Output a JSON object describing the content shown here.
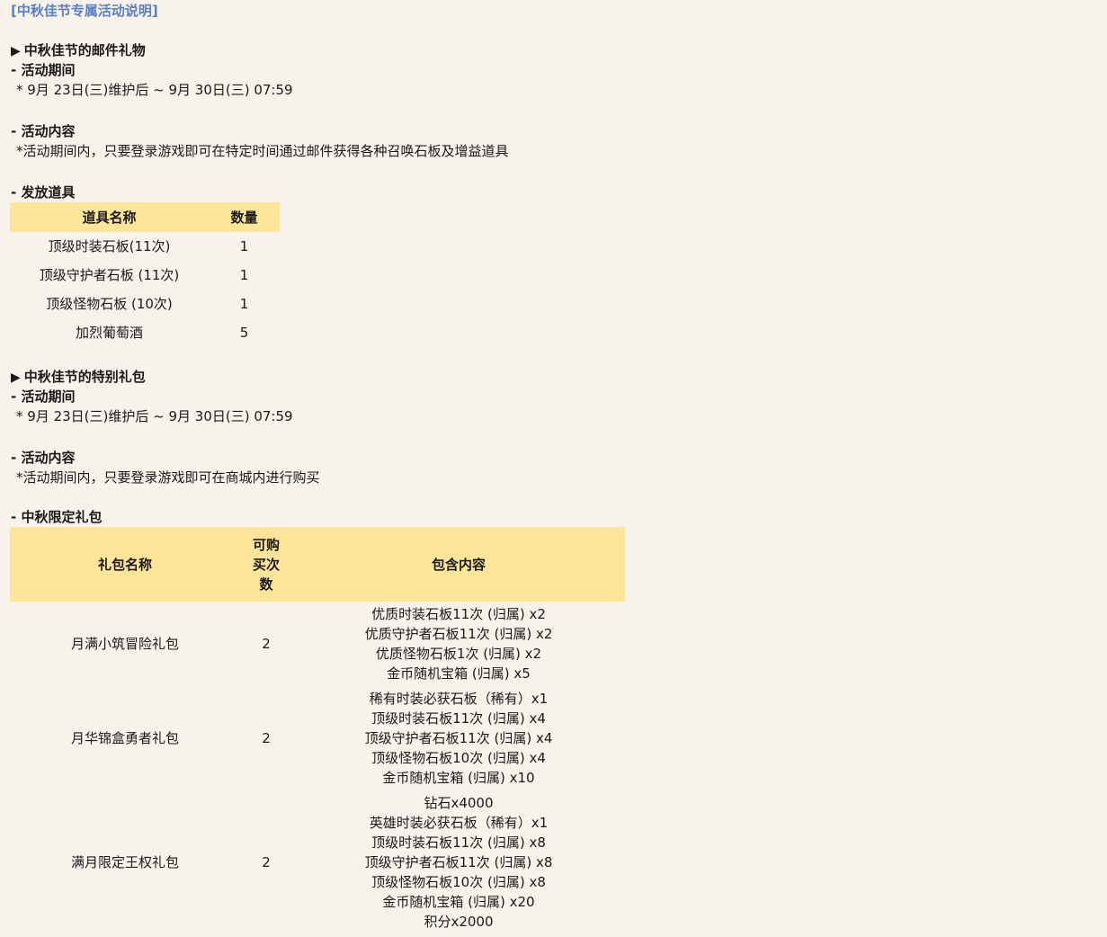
{
  "title": "[中秋佳节专属活动说明]",
  "section1": {
    "heading": "中秋佳节的邮件礼物",
    "period_label": "- 活动期间",
    "period_text": "* 9月 23日(三)维护后 ~ 9月 30日(三) 07:59",
    "content_label": "- 活动内容",
    "content_text": "*活动期间内，只要登录游戏即可在特定时间通过邮件获得各种召唤石板及增益道具",
    "items_label": "- 发放道具",
    "table": {
      "headers": [
        "道具名称",
        "数量"
      ],
      "rows": [
        [
          "顶级时装石板(11次)",
          "1"
        ],
        [
          "顶级守护者石板 (11次)",
          "1"
        ],
        [
          "顶级怪物石板 (10次)",
          "1"
        ],
        [
          "加烈葡萄酒",
          "5"
        ]
      ]
    }
  },
  "section2": {
    "heading": "中秋佳节的特别礼包",
    "period_label": "- 活动期间",
    "period_text": "* 9月 23日(三)维护后 ~ 9月 30日(三) 07:59",
    "content_label": "- 活动内容",
    "content_text": "*活动期间内，只要登录游戏即可在商城内进行购买",
    "packs_label": "- 中秋限定礼包",
    "table": {
      "headers": [
        "礼包名称",
        "可购\n买次\n数",
        "包含内容"
      ],
      "rows": [
        {
          "name": "月满小筑冒险礼包",
          "limit": "2",
          "contents": [
            "优质时装石板11次 (归属) x2",
            "优质守护者石板11次 (归属) x2",
            "优质怪物石板1次 (归属) x2",
            "金币随机宝箱 (归属) x5"
          ]
        },
        {
          "name": "月华锦盒勇者礼包",
          "limit": "2",
          "contents": [
            "稀有时装必获石板（稀有）x1",
            "顶级时装石板11次 (归属) x4",
            "顶级守护者石板11次 (归属) x4",
            "顶级怪物石板10次 (归属) x4",
            "金币随机宝箱 (归属) x10"
          ]
        },
        {
          "name": "满月限定王权礼包",
          "limit": "2",
          "contents": [
            "钻石x4000",
            "英雄时装必获石板（稀有）x1",
            "顶级时装石板11次 (归属) x8",
            "顶级守护者石板11次 (归属) x8",
            "顶级怪物石板10次 (归属) x8",
            "金币随机宝箱 (归属) x20",
            "积分x2000"
          ]
        }
      ]
    }
  },
  "icons": {
    "bullet": "triangle-right-icon"
  },
  "colors": {
    "background": "#f7f2ea",
    "title": "#5b7fc2",
    "table_header": "#ffe59a"
  }
}
